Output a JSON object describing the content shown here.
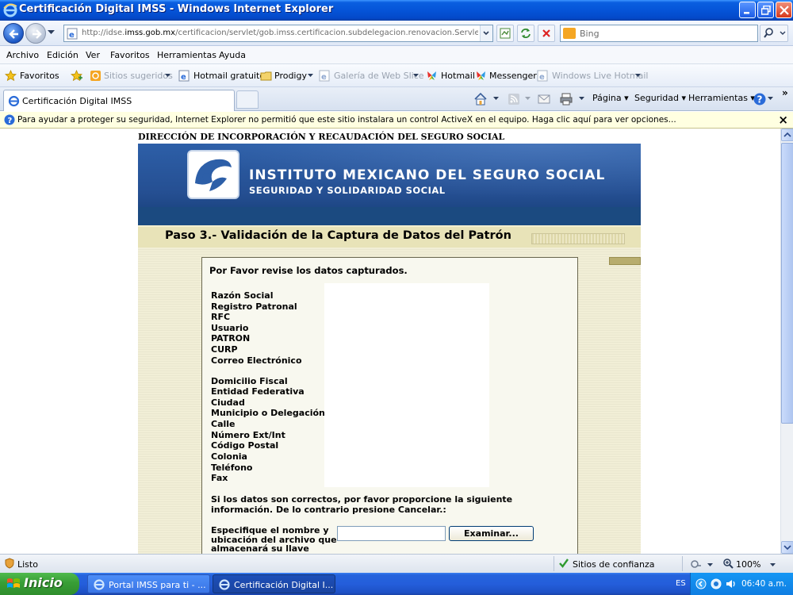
{
  "window": {
    "title": "Certificación Digital IMSS - Windows Internet Explorer"
  },
  "address_bar": {
    "url_prefix": "http://idse.",
    "url_domain": "imss.gob.mx",
    "url_path": "/certificacion/servlet/gob.imss.certificacion.subdelegacion.renovacion.ServletValid",
    "search_placeholder": "Bing"
  },
  "menu": {
    "items": [
      "Archivo",
      "Edición",
      "Ver",
      "Favoritos",
      "Herramientas",
      "Ayuda"
    ]
  },
  "favorites_bar": {
    "favoritos": "Favoritos",
    "items": [
      "Sitios sugeridos",
      "Hotmail gratuito",
      "Prodigy",
      "Galería de Web Slice",
      "Hotmail",
      "Messenger",
      "Windows Live Hotmail"
    ]
  },
  "tabs": {
    "active": "Certificación Digital IMSS"
  },
  "command_bar": {
    "pagina": "Página",
    "seguridad": "Seguridad",
    "herramientas": "Herramientas"
  },
  "infobar": {
    "message": "Para ayudar a proteger su seguridad, Internet Explorer no permitió que este sitio instalara un control ActiveX en el equipo. Haga clic aquí para ver opciones..."
  },
  "page": {
    "header": "DIRECCIÓN DE INCORPORACIÓN Y RECAUDACIÓN DEL SEGURO SOCIAL",
    "institute": "INSTITUTO MEXICANO DEL SEGURO SOCIAL",
    "motto": "SEGURIDAD Y SOLIDARIDAD SOCIAL",
    "step_title": "Paso 3.- Validación de la Captura de Datos del Patrón",
    "review_heading": "Por Favor revise los datos capturados.",
    "fields_group1": [
      "Razón Social",
      "Registro Patronal",
      "RFC",
      "Usuario",
      "PATRON",
      "CURP",
      "Correo Electrónico"
    ],
    "fields_group2": [
      "Domicilio Fiscal",
      "Entidad Federativa",
      "Ciudad",
      "Municipio o Delegación",
      "Calle",
      "Número Ext/Int",
      "Código Postal",
      "Colonia",
      "Teléfono",
      "Fax"
    ],
    "note": "Si los datos son correctos, por favor proporcione la siguiente información. De lo contrario presione Cancelar.:",
    "specify_label": "Especifique el nombre y ubicación del archivo que almacenará su llave",
    "browse_button": "Examinar..."
  },
  "status_bar": {
    "status": "Listo",
    "zone": "Sitios de confianza",
    "zoom": "100%"
  },
  "taskbar": {
    "start": "Inicio",
    "items": [
      "Portal IMSS para ti - ...",
      "Certificación Digital I..."
    ],
    "language": "ES",
    "clock": "06:40 a.m."
  }
}
